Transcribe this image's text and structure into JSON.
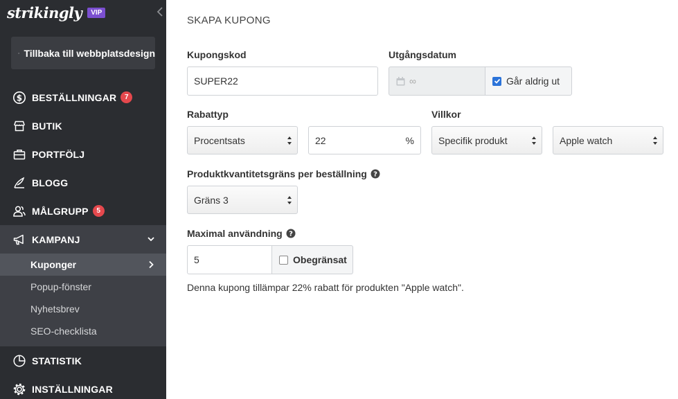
{
  "sidebar": {
    "logo": "strikingly",
    "vip": "VIP",
    "back_label": "Tillbaka till webbplatsdesign",
    "items": [
      {
        "label": "BESTÄLLNINGAR",
        "badge": "7"
      },
      {
        "label": "BUTIK"
      },
      {
        "label": "PORTFÖLJ"
      },
      {
        "label": "BLOGG"
      },
      {
        "label": "MÅLGRUPP",
        "badge": "5"
      },
      {
        "label": "KAMPANJ"
      }
    ],
    "subitems": [
      {
        "label": "Kuponger"
      },
      {
        "label": "Popup-fönster"
      },
      {
        "label": "Nyhetsbrev"
      },
      {
        "label": "SEO-checklista"
      }
    ],
    "items_bottom": [
      {
        "label": "STATISTIK"
      },
      {
        "label": "INSTÄLLNINGAR"
      }
    ]
  },
  "form": {
    "title": "SKAPA KUPONG",
    "code_label": "Kupongskod",
    "code_value": "SUPER22",
    "expiry_label": "Utgångsdatum",
    "expiry_value": "∞",
    "never_expires_label": "Går aldrig ut",
    "discount_type_label": "Rabattyp",
    "discount_type_value": "Procentsats",
    "discount_amount": "22",
    "discount_suffix": "%",
    "conditions_label": "Villkor",
    "condition_value": "Specifik produkt",
    "product_value": "Apple watch",
    "quantity_limit_label": "Produktkvantitetsgräns per beställning",
    "quantity_limit_value": "Gräns 3",
    "max_usage_label": "Maximal användning",
    "max_usage_value": "5",
    "unlimited_label": "Obegränsat",
    "summary": "Denna kupong tillämpar 22% rabatt för produkten \"Apple watch\"."
  },
  "colors": {
    "sidebar_bg": "#2b2d31",
    "vip_badge": "#7b4fd0",
    "alert_badge": "#e5484d",
    "checkbox": "#2b73d9"
  }
}
